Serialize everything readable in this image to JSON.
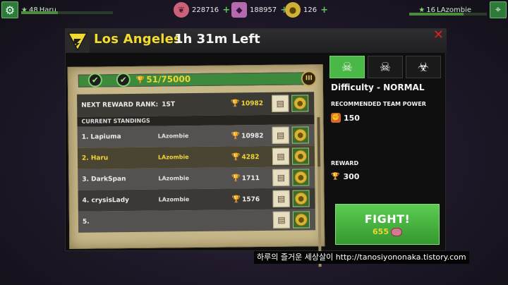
{
  "hud": {
    "player_level": "48",
    "player_name": "Haru",
    "brains": "228716",
    "gems": "188957",
    "coins": "126",
    "opponent_level": "16",
    "opponent_name": "LAzombie",
    "icons": {
      "settings": "gear-icon",
      "brains": "brain-icon",
      "gems": "gem-icon",
      "coins": "coin-icon",
      "map": "map-icon"
    }
  },
  "modal": {
    "city": "Los Angeles",
    "time_left": "1h 31m Left",
    "close_symbol": "✕"
  },
  "event": {
    "progress_text": "51/75000",
    "tier": "III",
    "progress_fraction": 0.00068,
    "next_reward_label": "NEXT REWARD RANK:",
    "next_reward_rank": "1ST",
    "next_reward_score": "10982",
    "standings_header": "CURRENT STANDINGS",
    "standings": [
      {
        "name": "1. Lapiuma",
        "guild": "LAzombie",
        "score": "10982",
        "me": false
      },
      {
        "name": "2. Haru",
        "guild": "LAzombie",
        "score": "4282",
        "me": true
      },
      {
        "name": "3. DarkSpan",
        "guild": "LAzombie",
        "score": "1711",
        "me": false
      },
      {
        "name": "4. crysisLady",
        "guild": "LAzombie",
        "score": "1576",
        "me": false
      },
      {
        "name": "5.",
        "guild": "",
        "score": "",
        "me": false
      }
    ]
  },
  "sidebar": {
    "difficulty": "Difficulty - NORMAL",
    "recommended_label": "RECOMMENDED TEAM POWER",
    "recommended_power": "150",
    "reward_label": "REWARD",
    "reward_value": "300",
    "fight_label": "FIGHT!",
    "fight_cost": "655"
  },
  "watermark": "하루의 즐거운 세상살이 http://tanosiyononaka.tistory.com",
  "colors": {
    "accent_green": "#49b847",
    "gold_text": "#f0d534",
    "close_red": "#e32020"
  }
}
